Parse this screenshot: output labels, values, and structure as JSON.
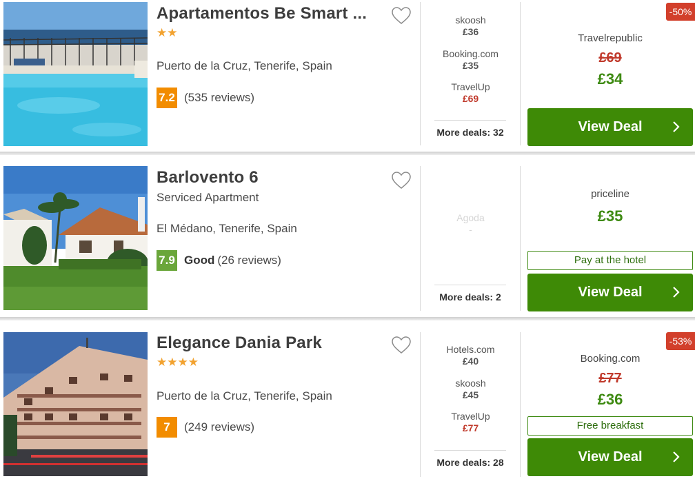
{
  "hotels": [
    {
      "name": "Apartamentos Be Smart ...",
      "stars": "★★",
      "subtype": "",
      "location": "Puerto de la Cruz, Tenerife, Spain",
      "score": "7.2",
      "score_word": "",
      "reviews": "(535 reviews)",
      "deals": [
        {
          "provider": "skoosh",
          "price": "£36"
        },
        {
          "provider": "Booking.com",
          "price": "£35"
        },
        {
          "provider": "TravelUp",
          "price": "£69"
        }
      ],
      "more_deals": "More deals: 32",
      "main_provider": "Travelrepublic",
      "old_price": "£69",
      "price": "£34",
      "badge": "",
      "discount": "-50%",
      "button": "View Deal"
    },
    {
      "name": "Barlovento 6",
      "stars": "",
      "subtype": "Serviced Apartment",
      "location": "El Médano, Tenerife, Spain",
      "score": "7.9",
      "score_word": "Good",
      "reviews": "(26 reviews)",
      "deals": [
        {
          "provider": "Agoda",
          "price": "-"
        }
      ],
      "more_deals": "More deals: 2",
      "main_provider": "priceline",
      "old_price": "",
      "price": "£35",
      "badge": "Pay at the hotel",
      "discount": "",
      "button": "View Deal"
    },
    {
      "name": "Elegance Dania Park",
      "stars": "★★★★",
      "subtype": "",
      "location": "Puerto de la Cruz, Tenerife, Spain",
      "score": "7",
      "score_word": "",
      "reviews": "(249 reviews)",
      "deals": [
        {
          "provider": "Hotels.com",
          "price": "£40"
        },
        {
          "provider": "skoosh",
          "price": "£45"
        },
        {
          "provider": "TravelUp",
          "price": "£77"
        }
      ],
      "more_deals": "More deals: 28",
      "main_provider": "Booking.com",
      "old_price": "£77",
      "price": "£36",
      "badge": "Free breakfast",
      "discount": "-53%",
      "button": "View Deal"
    }
  ],
  "colors": {
    "deal_green": "#3e8a06",
    "price_green": "#3e8a12",
    "discount_red": "#d23f2b",
    "score_orange": "#f28c00",
    "score_green": "#6aa63a",
    "star_gold": "#f2a230"
  },
  "icons": {
    "favorite": "heart-outline-icon",
    "button_arrow": "chevron-right-icon"
  }
}
